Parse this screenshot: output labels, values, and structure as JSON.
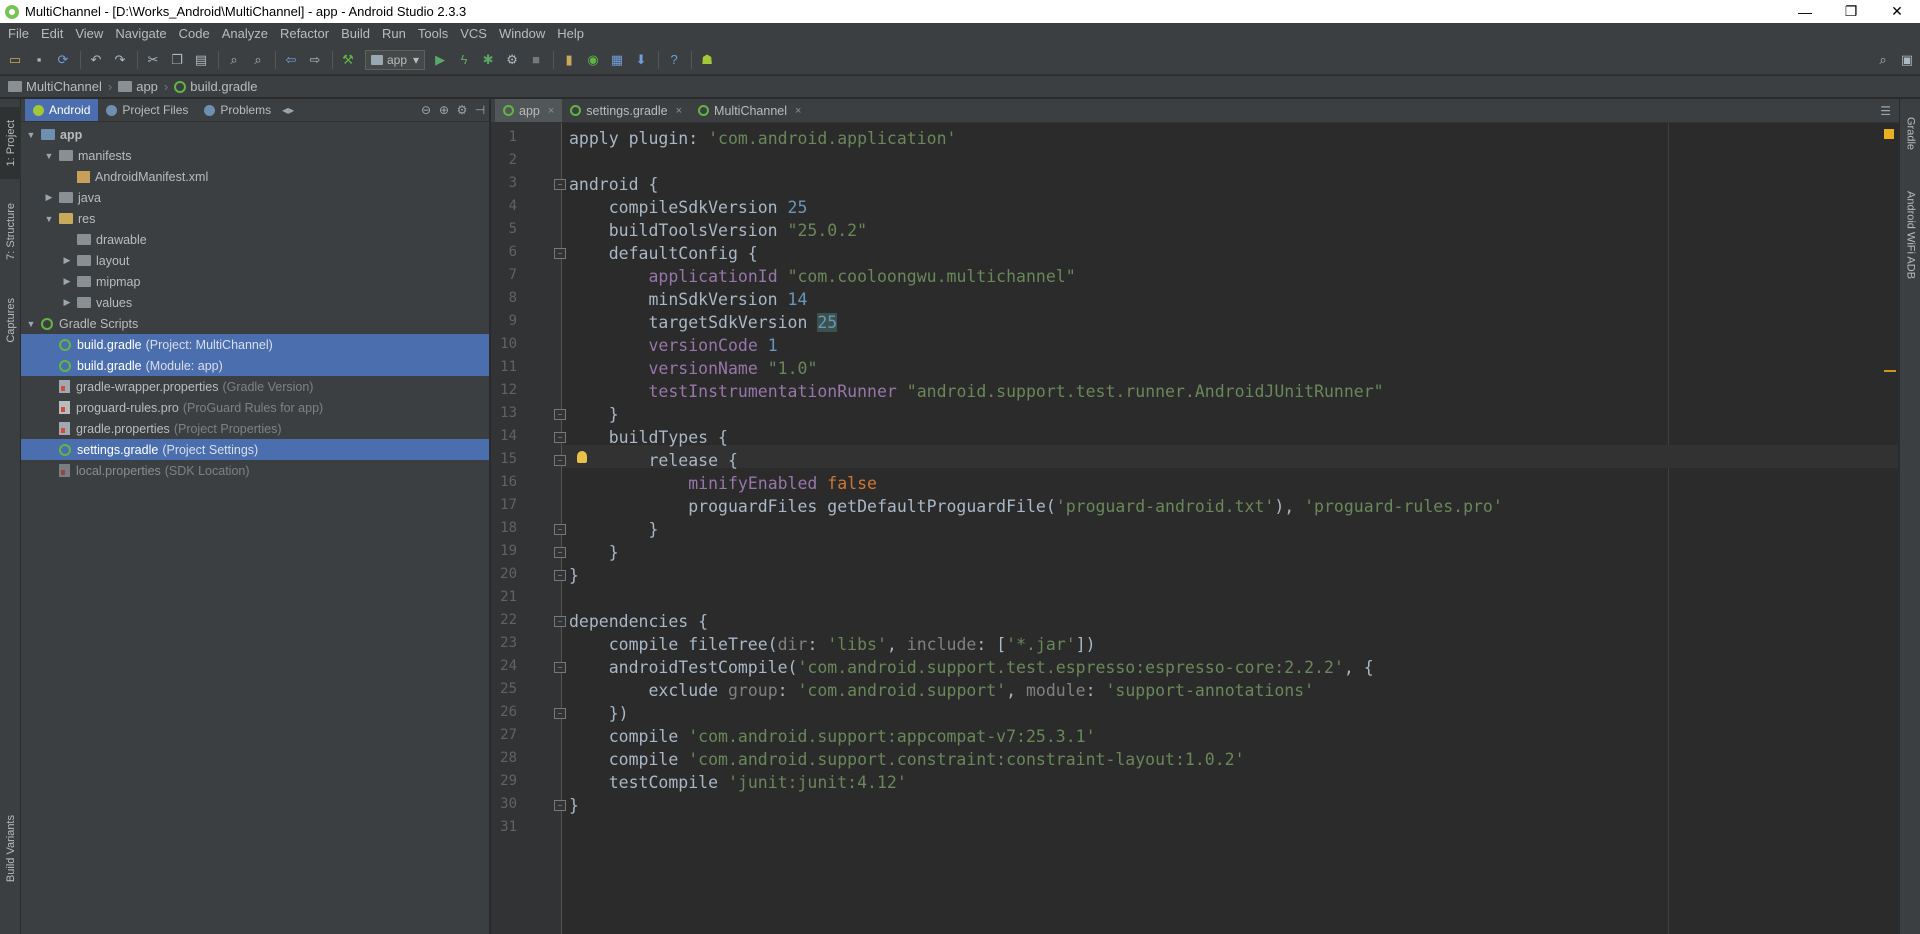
{
  "window": {
    "title": "MultiChannel - [D:\\Works_Android\\MultiChannel] - app - Android Studio 2.3.3",
    "minimize": "—",
    "restore": "❐",
    "close": "✕"
  },
  "menu": [
    "File",
    "Edit",
    "View",
    "Navigate",
    "Code",
    "Analyze",
    "Refactor",
    "Build",
    "Run",
    "Tools",
    "VCS",
    "Window",
    "Help"
  ],
  "toolbar": {
    "run_config": "app",
    "combo_arrow": "▾"
  },
  "breadcrumb": [
    "MultiChannel",
    "app",
    "build.gradle"
  ],
  "left_strip": [
    "1: Project",
    "7: Structure",
    "Captures",
    "Build Variants"
  ],
  "right_strip": [
    "Gradle",
    "Android WiFi ADB"
  ],
  "project_panel": {
    "tabs": [
      "Android",
      "Project Files",
      "Problems"
    ],
    "tree": [
      {
        "label": "app",
        "hint": ""
      },
      {
        "label": "manifests",
        "hint": ""
      },
      {
        "label": "AndroidManifest.xml",
        "hint": ""
      },
      {
        "label": "java",
        "hint": ""
      },
      {
        "label": "res",
        "hint": ""
      },
      {
        "label": "drawable",
        "hint": ""
      },
      {
        "label": "layout",
        "hint": ""
      },
      {
        "label": "mipmap",
        "hint": ""
      },
      {
        "label": "values",
        "hint": ""
      },
      {
        "label": "Gradle Scripts",
        "hint": ""
      },
      {
        "label": "build.gradle",
        "hint": "(Project: MultiChannel)"
      },
      {
        "label": "build.gradle",
        "hint": "(Module: app)"
      },
      {
        "label": "gradle-wrapper.properties",
        "hint": "(Gradle Version)"
      },
      {
        "label": "proguard-rules.pro",
        "hint": "(ProGuard Rules for app)"
      },
      {
        "label": "gradle.properties",
        "hint": "(Project Properties)"
      },
      {
        "label": "settings.gradle",
        "hint": "(Project Settings)"
      },
      {
        "label": "local.properties",
        "hint": "(SDK Location)"
      }
    ]
  },
  "editor": {
    "tabs": [
      "app",
      "settings.gradle",
      "MultiChannel"
    ],
    "tab_close": "×",
    "line_numbers": [
      "1",
      "2",
      "3",
      "4",
      "5",
      "6",
      "7",
      "8",
      "9",
      "10",
      "11",
      "12",
      "13",
      "14",
      "15",
      "16",
      "17",
      "18",
      "19",
      "20",
      "21",
      "22",
      "23",
      "24",
      "25",
      "26",
      "27",
      "28",
      "29",
      "30",
      "31"
    ],
    "code": [
      [
        [
          "apply ",
          ""
        ],
        [
          "plugin",
          ""
        ],
        [
          ": ",
          ""
        ],
        [
          "'com.android.application'",
          "str"
        ]
      ],
      [],
      [
        [
          "android {",
          ""
        ]
      ],
      [
        [
          "    compileSdkVersion ",
          ""
        ],
        [
          "25",
          "num"
        ]
      ],
      [
        [
          "    buildToolsVersion ",
          ""
        ],
        [
          "\"25.0.2\"",
          "str"
        ]
      ],
      [
        [
          "    defaultConfig {",
          ""
        ]
      ],
      [
        [
          "        ",
          ""
        ],
        [
          "applicationId",
          "prop"
        ],
        [
          " ",
          ""
        ],
        [
          "\"com.cooloongwu.multichannel\"",
          "str"
        ]
      ],
      [
        [
          "        minSdkVersion ",
          ""
        ],
        [
          "14",
          "num"
        ]
      ],
      [
        [
          "        targetSdkVersion ",
          ""
        ],
        [
          "25",
          "hlnum"
        ]
      ],
      [
        [
          "        ",
          ""
        ],
        [
          "versionCode",
          "prop"
        ],
        [
          " ",
          ""
        ],
        [
          "1",
          "num"
        ]
      ],
      [
        [
          "        ",
          ""
        ],
        [
          "versionName",
          "prop"
        ],
        [
          " ",
          ""
        ],
        [
          "\"1.0\"",
          "str"
        ]
      ],
      [
        [
          "        ",
          ""
        ],
        [
          "testInstrumentationRunner",
          "prop"
        ],
        [
          " ",
          ""
        ],
        [
          "\"android.support.test.runner.AndroidJUnitRunner\"",
          "str"
        ]
      ],
      [
        [
          "    }",
          ""
        ]
      ],
      [
        [
          "    buildTypes {",
          ""
        ]
      ],
      [
        [
          "        release {",
          ""
        ]
      ],
      [
        [
          "            ",
          ""
        ],
        [
          "minifyEnabled",
          "prop"
        ],
        [
          " ",
          ""
        ],
        [
          "false",
          "kw"
        ]
      ],
      [
        [
          "            proguardFiles getDefaultProguardFile(",
          ""
        ],
        [
          "'proguard-android.txt'",
          "str"
        ],
        [
          "), ",
          ""
        ],
        [
          "'proguard-rules.pro'",
          "str"
        ]
      ],
      [
        [
          "        }",
          ""
        ]
      ],
      [
        [
          "    }",
          ""
        ]
      ],
      [
        [
          "}",
          ""
        ]
      ],
      [],
      [
        [
          "dependencies {",
          ""
        ]
      ],
      [
        [
          "    compile fileTree(",
          ""
        ],
        [
          "dir",
          "dim"
        ],
        [
          ": ",
          ""
        ],
        [
          "'libs'",
          "str"
        ],
        [
          ", ",
          ""
        ],
        [
          "include",
          "dim"
        ],
        [
          ": [",
          ""
        ],
        [
          "'*.jar'",
          "str"
        ],
        [
          "])",
          ""
        ]
      ],
      [
        [
          "    androidTestCompile(",
          ""
        ],
        [
          "'com.android.support.test.espresso:espresso-core:2.2.2'",
          "str"
        ],
        [
          ", {",
          ""
        ]
      ],
      [
        [
          "        exclude ",
          ""
        ],
        [
          "group",
          "dim"
        ],
        [
          ": ",
          ""
        ],
        [
          "'com.android.support'",
          "str"
        ],
        [
          ", ",
          ""
        ],
        [
          "module",
          "dim"
        ],
        [
          ": ",
          ""
        ],
        [
          "'support-annotations'",
          "str"
        ]
      ],
      [
        [
          "    })",
          ""
        ]
      ],
      [
        [
          "    compile ",
          ""
        ],
        [
          "'com.android.support:appcompat-v7:25.3.1'",
          "str"
        ]
      ],
      [
        [
          "    compile ",
          ""
        ],
        [
          "'com.android.support.constraint:constraint-layout:1.0.2'",
          "str"
        ]
      ],
      [
        [
          "    testCompile ",
          ""
        ],
        [
          "'junit:junit:4.12'",
          "str"
        ]
      ],
      [
        [
          "}",
          ""
        ]
      ],
      []
    ]
  },
  "colors": {
    "background": "#2b2b2b",
    "keyword": "#cc7832",
    "string": "#6a8759",
    "number": "#6897bb",
    "property": "#9876aa",
    "selection": "#4b6eaf"
  }
}
